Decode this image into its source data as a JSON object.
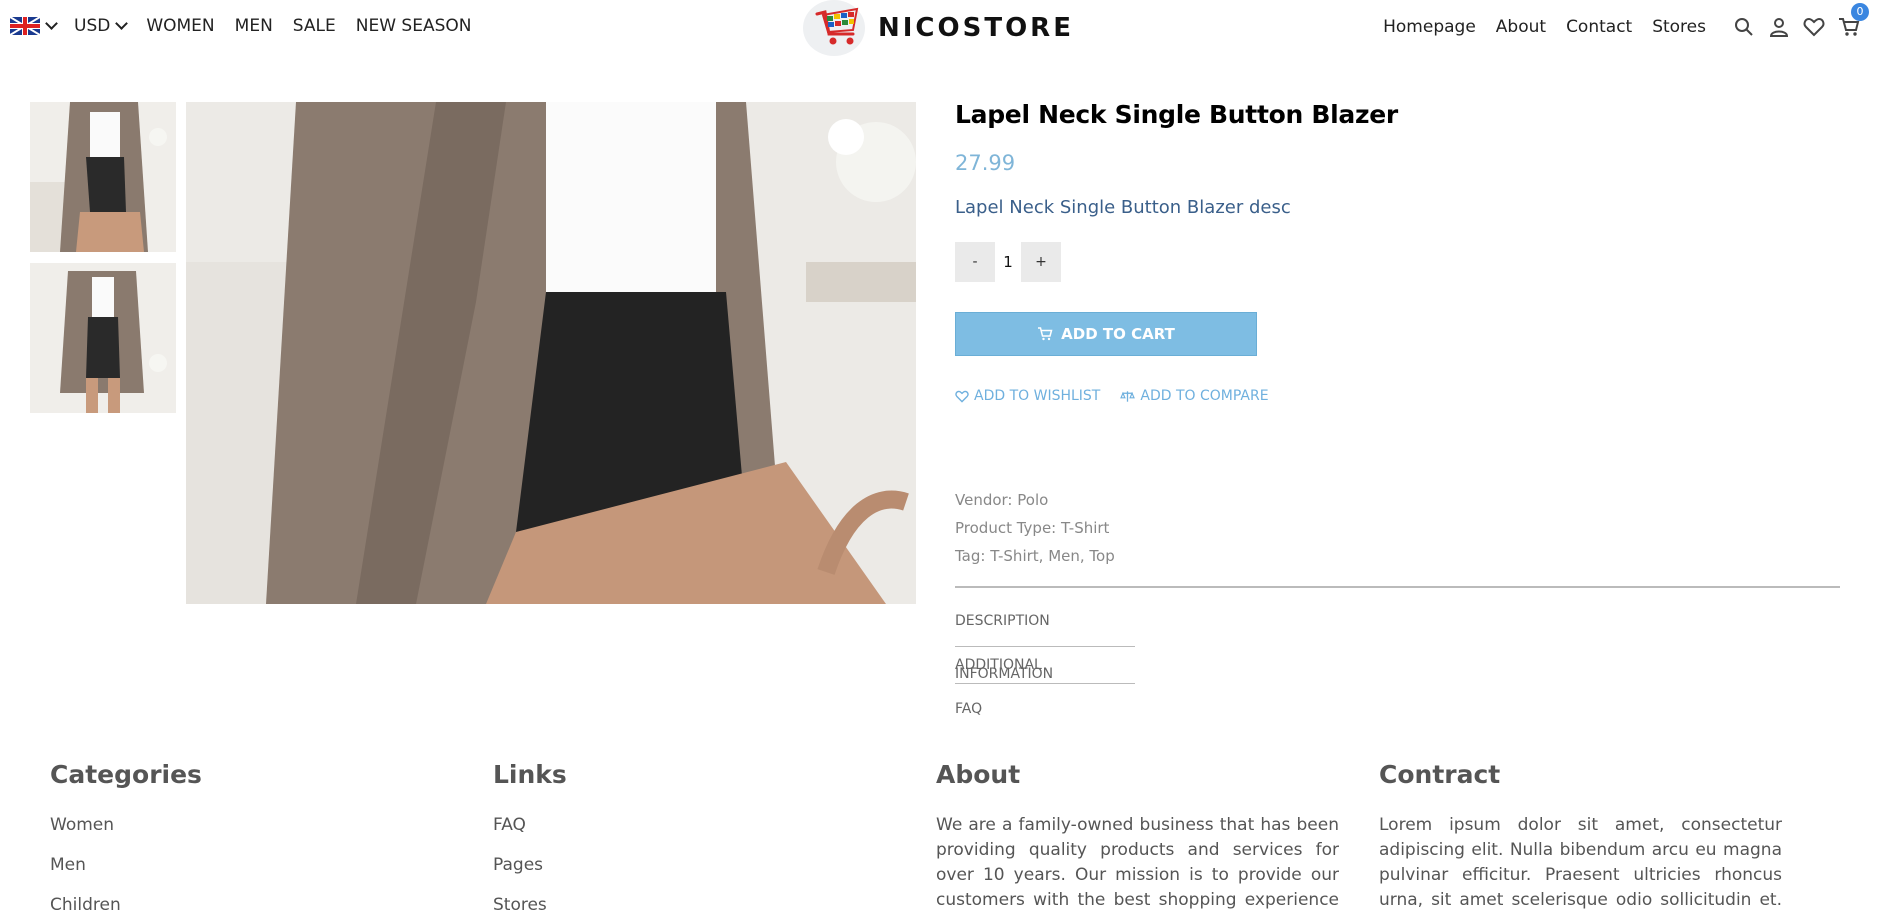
{
  "nav": {
    "currency": "USD",
    "categories": [
      "WOMEN",
      "MEN",
      "SALE",
      "NEW SEASON"
    ],
    "brand": "NICOSTORE",
    "links": [
      "Homepage",
      "About",
      "Contact",
      "Stores"
    ],
    "cart_count": "0"
  },
  "product": {
    "title": "Lapel Neck Single Button Blazer",
    "price": "27.99",
    "description": "Lapel Neck Single Button Blazer desc",
    "quantity": "1",
    "minus": "-",
    "plus": "+",
    "add_to_cart": "ADD TO CART",
    "add_to_wishlist": "ADD TO WISHLIST",
    "add_to_compare": "ADD TO COMPARE",
    "vendor": "Vendor: Polo",
    "type": "Product Type: T-Shirt",
    "tags": "Tag: T-Shirt, Men, Top",
    "tabs": [
      "DESCRIPTION",
      "ADDITIONAL INFORMATION",
      "FAQ"
    ]
  },
  "footer": {
    "categories_title": "Categories",
    "categories": [
      "Women",
      "Men",
      "Children"
    ],
    "links_title": "Links",
    "links": [
      "FAQ",
      "Pages",
      "Stores"
    ],
    "about_title": "About",
    "about_text": "We are a family-owned business that has been providing quality products and services for over 10 years. Our mission is to provide our customers with the best shopping experience possible. We",
    "contract_title": "Contract",
    "contract_text": "Lorem ipsum dolor sit amet, consectetur adipiscing elit. Nulla bibendum arcu eu magna pulvinar efficitur. Praesent ultricies rhoncus urna, sit amet scelerisque odio sollicitudin et. Phasellus"
  },
  "colors": {
    "accent": "#7ebde3",
    "price": "#7fb5d8",
    "badge": "#3a86e0"
  }
}
